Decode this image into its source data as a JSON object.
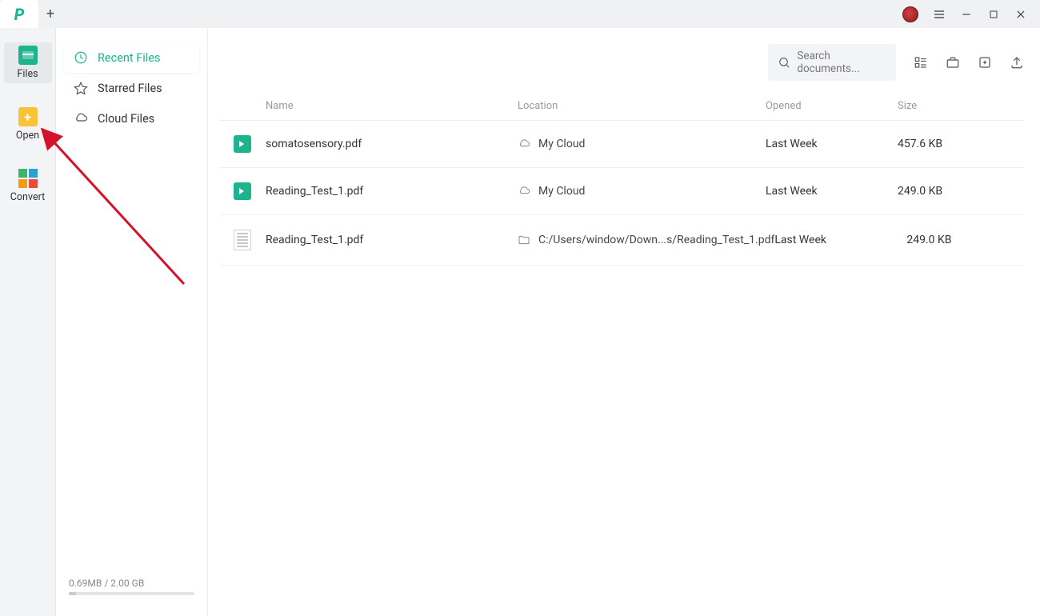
{
  "titlebar": {
    "plus": "+"
  },
  "leftbar": {
    "files": "Files",
    "open": "Open",
    "convert": "Convert"
  },
  "sidenav": {
    "recent": "Recent Files",
    "starred": "Starred Files",
    "cloud": "Cloud Files",
    "storage_used": "0.69MB",
    "storage_sep": " / ",
    "storage_total": "2.00 GB"
  },
  "search": {
    "placeholder": "Search documents..."
  },
  "columns": {
    "name": "Name",
    "location": "Location",
    "opened": "Opened",
    "size": "Size"
  },
  "rows": [
    {
      "icon": "pdf",
      "name": "somatosensory.pdf",
      "loc_icon": "cloud",
      "location": "My Cloud",
      "opened": "Last Week",
      "size": "457.6 KB"
    },
    {
      "icon": "pdf",
      "name": "Reading_Test_1.pdf",
      "loc_icon": "cloud",
      "location": "My Cloud",
      "opened": "Last Week",
      "size": "249.0 KB"
    },
    {
      "icon": "doc",
      "name": "Reading_Test_1.pdf",
      "loc_icon": "folder",
      "location": "C:/Users/window/Down...s/Reading_Test_1.pdf",
      "opened": "Last Week",
      "size": "249.0 KB"
    }
  ]
}
